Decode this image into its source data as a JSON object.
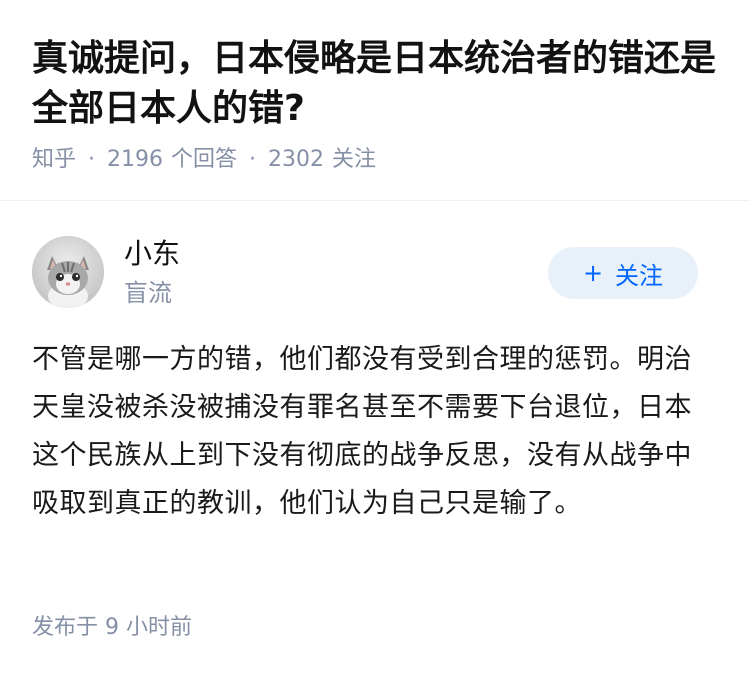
{
  "question": {
    "title": "真诚提问，日本侵略是日本统治者的错还是全部日本人的错?",
    "source": "知乎",
    "answer_count": "2196",
    "answer_label": "个回答",
    "follower_count": "2302",
    "follower_label": "关注",
    "separator": "·"
  },
  "author": {
    "name": "小东",
    "tag": "盲流",
    "avatar_icon": "kitten-avatar"
  },
  "follow_button": {
    "plus": "+",
    "label": "关注"
  },
  "answer": {
    "content": "不管是哪一方的错，他们都没有受到合理的惩罚。明治天皇没被杀没被捕没有罪名甚至不需要下台退位，日本这个民族从上到下没有彻底的战争反思，没有从战争中吸取到真正的教训，他们认为自己只是输了。"
  },
  "footer": {
    "published": "发布于 9 小时前"
  },
  "colors": {
    "accent": "#0066ff",
    "follow_bg": "#e8f0fa",
    "meta_gray": "#8590a6"
  }
}
